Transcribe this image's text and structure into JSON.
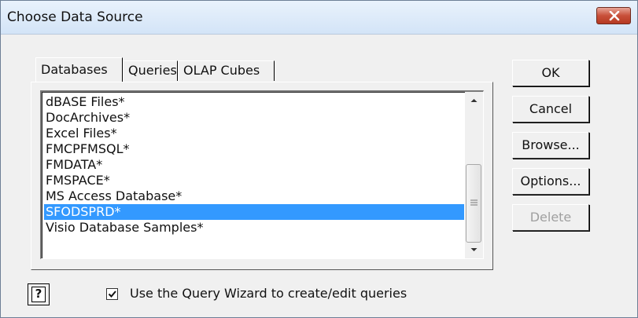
{
  "window": {
    "title": "Choose Data Source"
  },
  "tabs": [
    {
      "label": "Databases",
      "active": true
    },
    {
      "label": "Queries",
      "active": false
    },
    {
      "label": "OLAP Cubes",
      "active": false
    }
  ],
  "list": {
    "items": [
      "dBASE Files*",
      "DocArchives*",
      "Excel Files*",
      "FMCPFMSQL*",
      "FMDATA*",
      "FMSPACE*",
      "MS Access Database*",
      "SFODSPRD*",
      "Visio Database Samples*"
    ],
    "selected": "SFODSPRD*"
  },
  "buttons": {
    "ok": "OK",
    "cancel": "Cancel",
    "browse": "Browse...",
    "options": "Options...",
    "delete": "Delete"
  },
  "options": {
    "use_query_wizard_label": "Use the Query Wizard to create/edit queries",
    "use_query_wizard_checked": true,
    "help_glyph": "?"
  },
  "colors": {
    "selection": "#3399ff",
    "close_button": "#c84f39",
    "dialog_background": "#f0f0f0"
  },
  "icons": {
    "close": "close-icon",
    "help": "help-icon",
    "scroll_up": "chevron-up-icon",
    "scroll_down": "chevron-down-icon",
    "check": "check-icon"
  }
}
